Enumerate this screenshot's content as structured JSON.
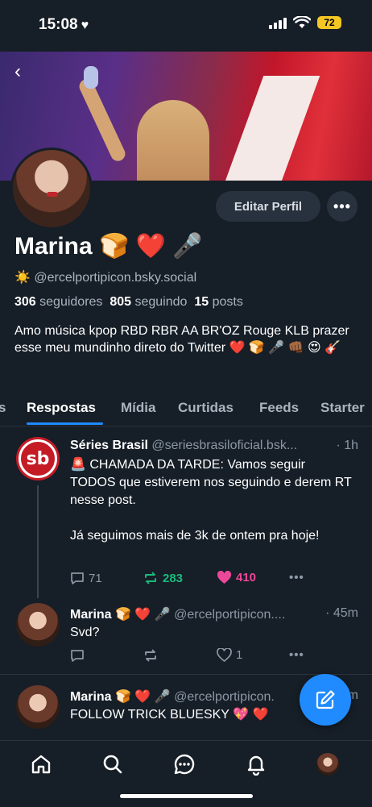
{
  "status_bar": {
    "time": "15:08",
    "time_icon": "♥",
    "battery": "72"
  },
  "profile": {
    "back_icon": "‹",
    "edit_button": "Editar Perfil",
    "more_icon": "•••",
    "name": "Marina 🍞 ❤️ 🎤",
    "handle_emoji": "☀️",
    "handle": "@ercelportipicon.bsky.social",
    "followers_count": "306",
    "followers_label": "seguidores",
    "following_count": "805",
    "following_label": "seguindo",
    "posts_count": "15",
    "posts_label": "posts",
    "bio": "Amo música kpop RBD RBR AA BR'OZ Rouge KLB prazer esse meu mundinho  direto do Twitter ❤️ 🍞 🎤 👊🏾 😍 🎸"
  },
  "tabs": [
    {
      "label": "s"
    },
    {
      "label": "Respostas",
      "active": true
    },
    {
      "label": "Mídia"
    },
    {
      "label": "Curtidas"
    },
    {
      "label": "Feeds"
    },
    {
      "label": "Starter"
    }
  ],
  "posts": [
    {
      "author": "Séries Brasil",
      "handle": "@seriesbrasiloficial.bsk...",
      "time": "· 1h",
      "avatar_text": "sb",
      "body": "🚨 CHAMADA DA TARDE: Vamos seguir TODOS que estiverem nos seguindo e derem RT nesse post.\n\nJá seguimos mais de 3k de ontem pra hoje!",
      "replies": "71",
      "reposts": "283",
      "likes": "410",
      "more": "•••"
    },
    {
      "author": "Marina 🍞 ❤️ 🎤",
      "handle": "@ercelportipicon....",
      "time": "· 45m",
      "body": "Svd?",
      "replies": "",
      "reposts": "",
      "likes": "1",
      "more": "•••"
    },
    {
      "author": "Marina 🍞 ❤️ 🎤",
      "handle": "@ercelportipicon.",
      "time": "m",
      "body": "FOLLOW TRICK BLUESKY 💖 ❤️"
    }
  ],
  "colors": {
    "accent": "#208bfe",
    "background": "#161e27",
    "repost": "#19bb7c",
    "like": "#ec4899"
  },
  "bottom_nav": [
    "home-icon",
    "search-icon",
    "chat-icon",
    "bell-icon",
    "profile-avatar"
  ]
}
